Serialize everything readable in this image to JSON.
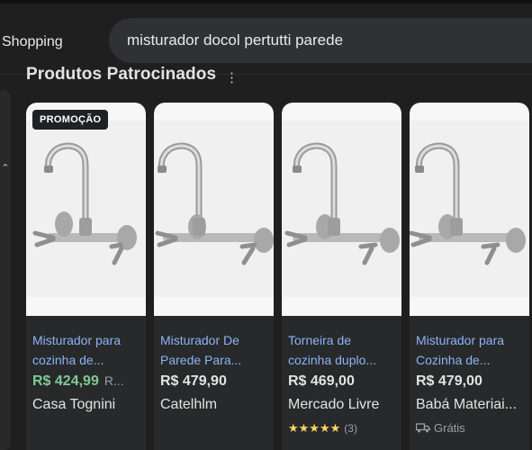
{
  "header": {
    "brand_label": "Shopping",
    "search_query": "misturador docol pertutti parede"
  },
  "section": {
    "title": "Produtos Patrocinados",
    "menu_glyph": "⋮"
  },
  "nav": {
    "collapse_glyph": "⌃"
  },
  "products": [
    {
      "badge": "PROMOÇÃO",
      "title": "Misturador para cozinha de...",
      "price": "R$ 424,99",
      "old_price": "R...",
      "price_color": "#81c995",
      "store": "Casa Tognini",
      "image": "faucet-image"
    },
    {
      "title": "Misturador De Parede Para...",
      "price": "R$ 479,90",
      "store": "Catelhlm",
      "image": "faucet-image"
    },
    {
      "title": "Torneira de cozinha duplo...",
      "price": "R$ 469,00",
      "store": "Mercado Livre",
      "rating_stars": "★★★★★",
      "rating_count": "(3)",
      "image": "faucet-image"
    },
    {
      "title": "Misturador para Cozinha de...",
      "price": "R$ 479,00",
      "store": "Babá Materiai...",
      "shipping": "Grátis",
      "image": "faucet-image"
    }
  ],
  "colors": {
    "background": "#1f1f1f",
    "card": "#28292a",
    "link": "#8ab4f8",
    "sale_price": "#81c995",
    "star": "#fdd663"
  }
}
